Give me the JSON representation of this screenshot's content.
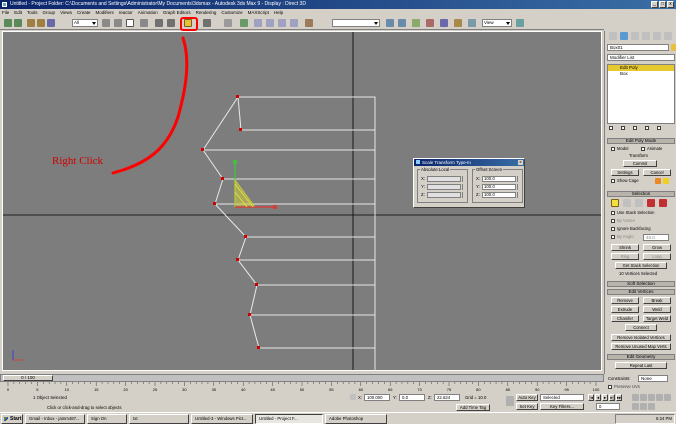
{
  "window": {
    "title": "Untitled - Project Folder: C:\\Documents and Settings\\Administrator\\My Documents\\3dsmax - Autodesk 3ds Max 9 - Display : Direct 3D",
    "minimize": "_",
    "maximize": "□",
    "close": "x"
  },
  "menu": [
    "File",
    "Edit",
    "Tools",
    "Group",
    "Views",
    "Create",
    "Modifiers",
    "reactor",
    "Animation",
    "Graph Editors",
    "Rendering",
    "Customize",
    "MAXScript",
    "Help"
  ],
  "toolbar": {
    "selection_filter": "All",
    "named_selection": "",
    "view_combo": "View"
  },
  "annotation": {
    "text": "Right Click",
    "color": "#d00000"
  },
  "viewport": {
    "label": ""
  },
  "dialog": {
    "title": "Scale Transform Type-In",
    "close": "x",
    "absolute": {
      "group": "Absolute:Local",
      "x_label": "X:",
      "x_value": "",
      "y_label": "Y:",
      "y_value": "",
      "z_label": "Z:",
      "z_value": ""
    },
    "offset": {
      "group": "Offset:Screen",
      "x_label": "X:",
      "x_value": "100.0",
      "y_label": "Y:",
      "y_value": "100.0",
      "z_label": "Z:",
      "z_value": "100.0"
    }
  },
  "command_panel": {
    "object_name": "Box01",
    "modifier_list": "Modifier List",
    "stack": [
      {
        "label": "Edit Poly",
        "selected": true
      },
      {
        "label": "Box",
        "selected": false
      }
    ],
    "edit_poly_mode": {
      "title": "Edit Poly Mode",
      "model": "Model",
      "animate": "Animate",
      "transform": "Transform",
      "commit": "Commit",
      "settings": "Settings",
      "cancel": "Cancel",
      "show_cage": "Show Cage"
    },
    "selection": {
      "title": "Selection",
      "use_stack": "Use Stack Selection",
      "by_vertex": "By Vertex",
      "ignore_backfacing": "Ignore Backfacing",
      "by_angle": "By Angle:",
      "by_angle_value": "45.0",
      "shrink": "Shrink",
      "grow": "Grow",
      "ring": "Ring",
      "loop": "Loop",
      "get_stack": "Get Stack Selection",
      "status": "10 Vertices Selected"
    },
    "soft_selection": "Soft Selection",
    "edit_vertices": {
      "title": "Edit Vertices",
      "remove": "Remove",
      "break": "Break",
      "extrude": "Extrude",
      "weld": "Weld",
      "chamfer": "Chamfer",
      "target_weld": "Target Weld",
      "connect": "Connect",
      "remove_isolated": "Remove Isolated Vertices",
      "remove_unused": "Remove Unused Map Verts"
    },
    "edit_geometry": {
      "title": "Edit Geometry",
      "repeat_last": "Repeat Last",
      "constraints": "Constraints:",
      "constraints_value": "None",
      "preserve_uvs": "Preserve UVs"
    }
  },
  "timeline": {
    "frame": "0 / 100",
    "ticks": [
      "0",
      "5",
      "10",
      "15",
      "20",
      "25",
      "30",
      "35",
      "40",
      "45",
      "50",
      "55",
      "60",
      "65",
      "70",
      "75",
      "80",
      "85",
      "90",
      "95",
      "100"
    ]
  },
  "status": {
    "selected": "1 Object Selected",
    "prompt": "Click or click-and-drag to select objects",
    "x_label": "X:",
    "x_value": "100.000",
    "y_label": "Y:",
    "y_value": "0.0",
    "z_label": "Z:",
    "z_value": "22.624",
    "grid": "Grid = 10.0",
    "add_time_tag": "Add Time Tag",
    "auto_key": "Auto Key",
    "set_key": "Set Key",
    "key_mode": "Selected",
    "key_filters": "Key Filters...",
    "frame_field": "0"
  },
  "taskbar": {
    "start": "Start",
    "tasks": [
      {
        "label": "Gmail - Inbox - jamm487...",
        "active": false
      },
      {
        "label": "Sign On",
        "active": false
      },
      {
        "label": "txt",
        "active": false
      },
      {
        "label": "Untitled-3 - Windows Pict...",
        "active": false
      },
      {
        "label": "Untitled - Project F...",
        "active": true
      },
      {
        "label": "Adobe Photoshop",
        "active": false
      }
    ],
    "clock": "6:24 PM"
  }
}
